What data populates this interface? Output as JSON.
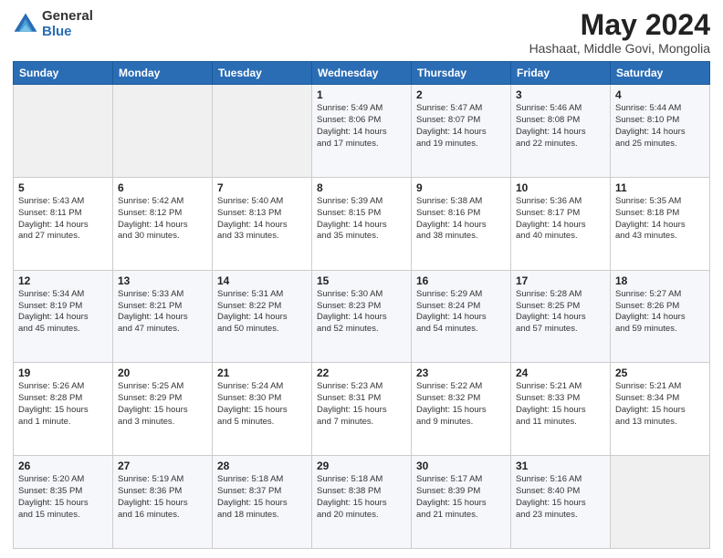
{
  "logo": {
    "general": "General",
    "blue": "Blue"
  },
  "header": {
    "month_title": "May 2024",
    "location": "Hashaat, Middle Govi, Mongolia"
  },
  "weekdays": [
    "Sunday",
    "Monday",
    "Tuesday",
    "Wednesday",
    "Thursday",
    "Friday",
    "Saturday"
  ],
  "weeks": [
    [
      {
        "day": "",
        "content": ""
      },
      {
        "day": "",
        "content": ""
      },
      {
        "day": "",
        "content": ""
      },
      {
        "day": "1",
        "content": "Sunrise: 5:49 AM\nSunset: 8:06 PM\nDaylight: 14 hours\nand 17 minutes."
      },
      {
        "day": "2",
        "content": "Sunrise: 5:47 AM\nSunset: 8:07 PM\nDaylight: 14 hours\nand 19 minutes."
      },
      {
        "day": "3",
        "content": "Sunrise: 5:46 AM\nSunset: 8:08 PM\nDaylight: 14 hours\nand 22 minutes."
      },
      {
        "day": "4",
        "content": "Sunrise: 5:44 AM\nSunset: 8:10 PM\nDaylight: 14 hours\nand 25 minutes."
      }
    ],
    [
      {
        "day": "5",
        "content": "Sunrise: 5:43 AM\nSunset: 8:11 PM\nDaylight: 14 hours\nand 27 minutes."
      },
      {
        "day": "6",
        "content": "Sunrise: 5:42 AM\nSunset: 8:12 PM\nDaylight: 14 hours\nand 30 minutes."
      },
      {
        "day": "7",
        "content": "Sunrise: 5:40 AM\nSunset: 8:13 PM\nDaylight: 14 hours\nand 33 minutes."
      },
      {
        "day": "8",
        "content": "Sunrise: 5:39 AM\nSunset: 8:15 PM\nDaylight: 14 hours\nand 35 minutes."
      },
      {
        "day": "9",
        "content": "Sunrise: 5:38 AM\nSunset: 8:16 PM\nDaylight: 14 hours\nand 38 minutes."
      },
      {
        "day": "10",
        "content": "Sunrise: 5:36 AM\nSunset: 8:17 PM\nDaylight: 14 hours\nand 40 minutes."
      },
      {
        "day": "11",
        "content": "Sunrise: 5:35 AM\nSunset: 8:18 PM\nDaylight: 14 hours\nand 43 minutes."
      }
    ],
    [
      {
        "day": "12",
        "content": "Sunrise: 5:34 AM\nSunset: 8:19 PM\nDaylight: 14 hours\nand 45 minutes."
      },
      {
        "day": "13",
        "content": "Sunrise: 5:33 AM\nSunset: 8:21 PM\nDaylight: 14 hours\nand 47 minutes."
      },
      {
        "day": "14",
        "content": "Sunrise: 5:31 AM\nSunset: 8:22 PM\nDaylight: 14 hours\nand 50 minutes."
      },
      {
        "day": "15",
        "content": "Sunrise: 5:30 AM\nSunset: 8:23 PM\nDaylight: 14 hours\nand 52 minutes."
      },
      {
        "day": "16",
        "content": "Sunrise: 5:29 AM\nSunset: 8:24 PM\nDaylight: 14 hours\nand 54 minutes."
      },
      {
        "day": "17",
        "content": "Sunrise: 5:28 AM\nSunset: 8:25 PM\nDaylight: 14 hours\nand 57 minutes."
      },
      {
        "day": "18",
        "content": "Sunrise: 5:27 AM\nSunset: 8:26 PM\nDaylight: 14 hours\nand 59 minutes."
      }
    ],
    [
      {
        "day": "19",
        "content": "Sunrise: 5:26 AM\nSunset: 8:28 PM\nDaylight: 15 hours\nand 1 minute."
      },
      {
        "day": "20",
        "content": "Sunrise: 5:25 AM\nSunset: 8:29 PM\nDaylight: 15 hours\nand 3 minutes."
      },
      {
        "day": "21",
        "content": "Sunrise: 5:24 AM\nSunset: 8:30 PM\nDaylight: 15 hours\nand 5 minutes."
      },
      {
        "day": "22",
        "content": "Sunrise: 5:23 AM\nSunset: 8:31 PM\nDaylight: 15 hours\nand 7 minutes."
      },
      {
        "day": "23",
        "content": "Sunrise: 5:22 AM\nSunset: 8:32 PM\nDaylight: 15 hours\nand 9 minutes."
      },
      {
        "day": "24",
        "content": "Sunrise: 5:21 AM\nSunset: 8:33 PM\nDaylight: 15 hours\nand 11 minutes."
      },
      {
        "day": "25",
        "content": "Sunrise: 5:21 AM\nSunset: 8:34 PM\nDaylight: 15 hours\nand 13 minutes."
      }
    ],
    [
      {
        "day": "26",
        "content": "Sunrise: 5:20 AM\nSunset: 8:35 PM\nDaylight: 15 hours\nand 15 minutes."
      },
      {
        "day": "27",
        "content": "Sunrise: 5:19 AM\nSunset: 8:36 PM\nDaylight: 15 hours\nand 16 minutes."
      },
      {
        "day": "28",
        "content": "Sunrise: 5:18 AM\nSunset: 8:37 PM\nDaylight: 15 hours\nand 18 minutes."
      },
      {
        "day": "29",
        "content": "Sunrise: 5:18 AM\nSunset: 8:38 PM\nDaylight: 15 hours\nand 20 minutes."
      },
      {
        "day": "30",
        "content": "Sunrise: 5:17 AM\nSunset: 8:39 PM\nDaylight: 15 hours\nand 21 minutes."
      },
      {
        "day": "31",
        "content": "Sunrise: 5:16 AM\nSunset: 8:40 PM\nDaylight: 15 hours\nand 23 minutes."
      },
      {
        "day": "",
        "content": ""
      }
    ]
  ]
}
